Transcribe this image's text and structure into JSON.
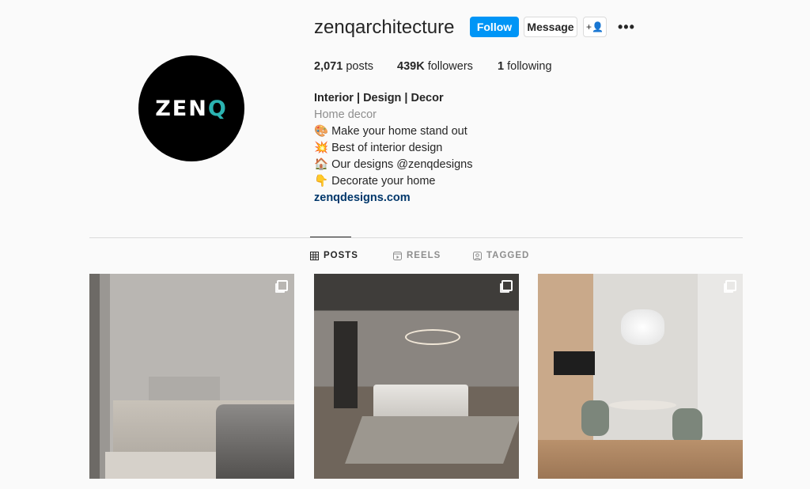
{
  "profile": {
    "username": "zenqarchitecture",
    "avatar_logo_text": "ZENQ",
    "follow_label": "Follow",
    "message_label": "Message",
    "add_user_icon": "+👤",
    "more_icon": "•••",
    "stats": {
      "posts_count": "2,071",
      "posts_label": "posts",
      "followers_count": "439K",
      "followers_label": "followers",
      "following_count": "1",
      "following_label": "following"
    },
    "bio": {
      "name": "Interior | Design | Decor",
      "category": "Home decor",
      "lines": [
        {
          "emoji": "🎨",
          "text": "Make your home stand out"
        },
        {
          "emoji": "💥",
          "text": "Best of interior design"
        },
        {
          "emoji": "🏠",
          "text": "Our designs @zenqdesigns"
        },
        {
          "emoji": "👇",
          "text": "Decorate your home"
        }
      ],
      "link": "zenqdesigns.com"
    }
  },
  "tabs": [
    {
      "label": "POSTS",
      "icon": "grid-icon",
      "active": true
    },
    {
      "label": "REELS",
      "icon": "reels-icon",
      "active": false
    },
    {
      "label": "TAGGED",
      "icon": "tagged-icon",
      "active": false
    }
  ],
  "accent": "#0095f6"
}
